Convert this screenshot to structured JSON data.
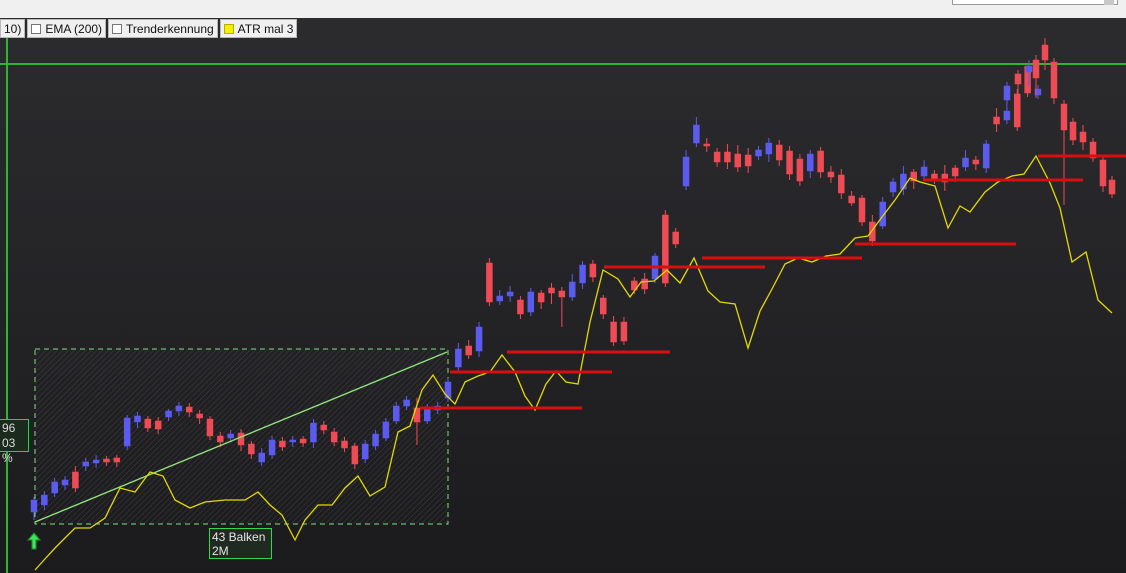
{
  "legend": {
    "items": [
      {
        "label": "10)",
        "checkbox": "none"
      },
      {
        "label": "EMA (200)",
        "checkbox": "unchecked"
      },
      {
        "label": "Trenderkennung",
        "checkbox": "unchecked"
      },
      {
        "label": "ATR mal 3",
        "checkbox": "yellow"
      }
    ]
  },
  "annotations": {
    "side_label_line1": "96",
    "side_label_line2": "03 %",
    "range_bars_line1": "43 Balken",
    "range_bars_line2": "2M"
  },
  "colors": {
    "up": "#5b5bf0",
    "down": "#ef4b55",
    "atr_line": "#e3d900",
    "trend_line": "#8ee07a",
    "horizontal_level": "#d90f0f",
    "crosshair": "#2db634",
    "range_box": "#7fe07f"
  },
  "icons": {
    "signal_arrow": "green-up-arrow-icon"
  },
  "chart_data": {
    "type": "candlestick",
    "bars": 98,
    "series": [
      {
        "name": "ATR mal 3",
        "type": "line"
      }
    ],
    "markers": [
      "trend-line",
      "range-box",
      "horizontal-stop-levels",
      "crosshair"
    ]
  }
}
